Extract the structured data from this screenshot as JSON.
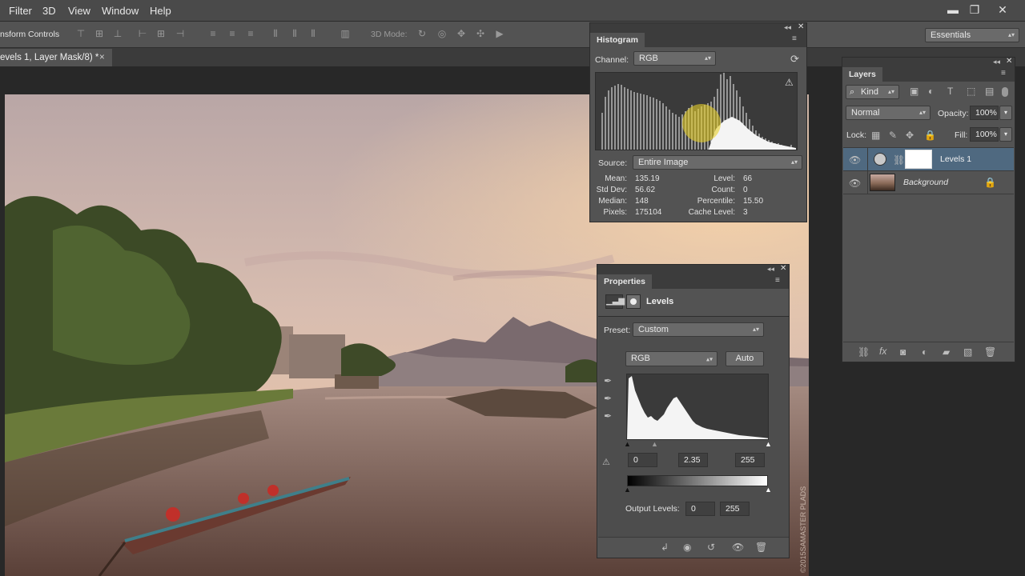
{
  "menu": {
    "items": [
      "Filter",
      "3D",
      "View",
      "Window",
      "Help"
    ]
  },
  "window_controls": {
    "minimize": "▬",
    "restore": "❐",
    "close": "✕"
  },
  "options_bar": {
    "label": "nsform Controls",
    "mode_label": "3D Mode:",
    "workspace": "Essentials"
  },
  "document": {
    "tab_title": "evels 1, Layer Mask/8) *",
    "close": "×",
    "watermark": "©2015SAMASTER PLADS"
  },
  "histogram": {
    "title": "Histogram",
    "channel_label": "Channel:",
    "channel_value": "RGB",
    "source_label": "Source:",
    "source_value": "Entire Image",
    "stats": {
      "mean_label": "Mean:",
      "mean": "135.19",
      "stddev_label": "Std Dev:",
      "stddev": "56.62",
      "median_label": "Median:",
      "median": "148",
      "pixels_label": "Pixels:",
      "pixels": "175104",
      "level_label": "Level:",
      "level": "66",
      "count_label": "Count:",
      "count": "0",
      "percentile_label": "Percentile:",
      "percentile": "15.50",
      "cache_label": "Cache Level:",
      "cache": "3"
    }
  },
  "properties": {
    "title": "Properties",
    "adjustment": "Levels",
    "preset_label": "Preset:",
    "preset_value": "Custom",
    "channel_value": "RGB",
    "auto_label": "Auto",
    "input_black": "0",
    "input_gamma": "2.35",
    "input_white": "255",
    "output_label": "Output Levels:",
    "output_black": "0",
    "output_white": "255"
  },
  "layers": {
    "title": "Layers",
    "filter_kind": "Kind",
    "blend_mode": "Normal",
    "opacity_label": "Opacity:",
    "opacity_value": "100%",
    "lock_label": "Lock:",
    "fill_label": "Fill:",
    "fill_value": "100%",
    "items": [
      {
        "name": "Levels 1",
        "selected": true
      },
      {
        "name": "Background",
        "selected": false
      }
    ]
  }
}
